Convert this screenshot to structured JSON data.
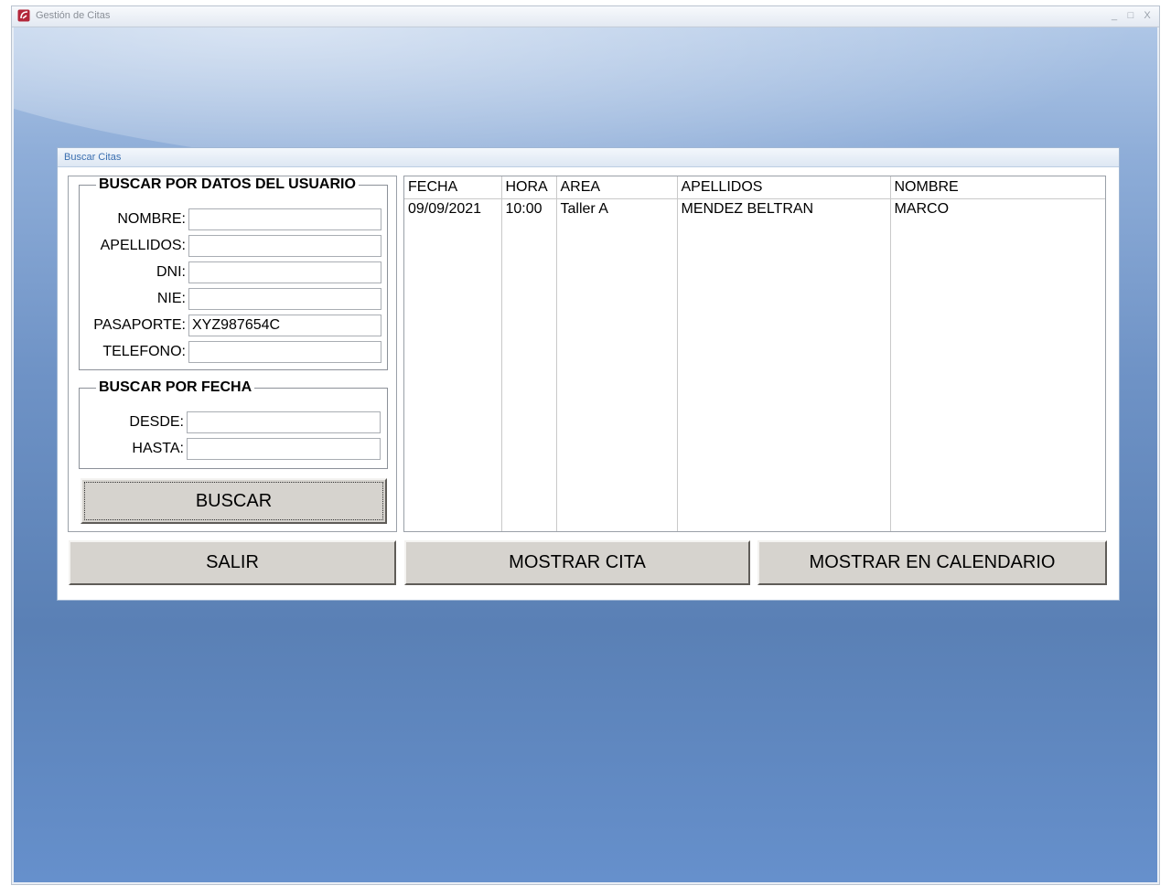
{
  "window": {
    "title": "Gestión de Citas",
    "controls": [
      "_",
      "□",
      "X"
    ]
  },
  "dialog": {
    "title": "Buscar Citas"
  },
  "user_search": {
    "legend": "BUSCAR POR DATOS DEL USUARIO",
    "fields": [
      {
        "label": "NOMBRE:",
        "value": ""
      },
      {
        "label": "APELLIDOS:",
        "value": ""
      },
      {
        "label": "DNI:",
        "value": ""
      },
      {
        "label": "NIE:",
        "value": ""
      },
      {
        "label": "PASAPORTE:",
        "value": "XYZ987654C"
      },
      {
        "label": "TELEFONO:",
        "value": ""
      }
    ]
  },
  "date_search": {
    "legend": "BUSCAR POR FECHA",
    "fields": [
      {
        "label": "DESDE:",
        "value": ""
      },
      {
        "label": "HASTA:",
        "value": ""
      }
    ]
  },
  "buttons": {
    "search": "BUSCAR",
    "exit": "SALIR",
    "show": "MOSTRAR CITA",
    "calendar": "MOSTRAR EN CALENDARIO"
  },
  "results": {
    "columns": [
      "FECHA",
      "HORA",
      "AREA",
      "APELLIDOS",
      "NOMBRE"
    ],
    "rows": [
      [
        "09/09/2021",
        "10:00",
        "Taller A",
        "MENDEZ BELTRAN",
        "MARCO"
      ]
    ]
  },
  "colors": {
    "button_face": "#d6d3ce",
    "dialog_title": "#3b6fb0",
    "desktop_blue": "#5a80b5"
  }
}
